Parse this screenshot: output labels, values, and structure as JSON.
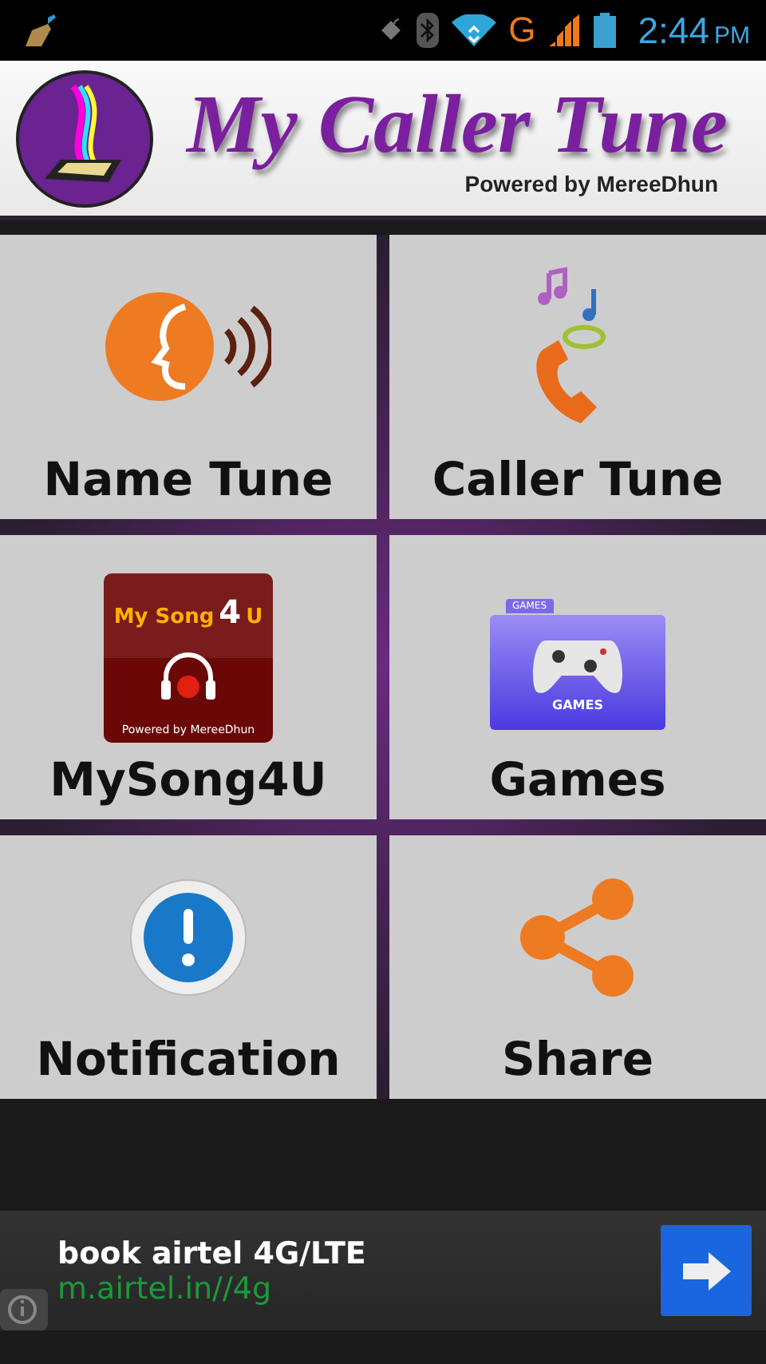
{
  "status_bar": {
    "network": "G",
    "time": "2:44",
    "ampm": "PM"
  },
  "header": {
    "title": "My Caller Tune",
    "subtitle": "Powered by MereeDhun"
  },
  "tiles": [
    {
      "kind": "name",
      "label": "Name Tune"
    },
    {
      "kind": "caller",
      "label": "Caller Tune"
    },
    {
      "kind": "mysong",
      "label": "MySong4U",
      "icon_title": "My Song",
      "icon_num": "4",
      "icon_u": "U",
      "icon_caption": "Powered by MereeDhun"
    },
    {
      "kind": "games",
      "label": "Games",
      "icon_tab": "GAMES",
      "icon_caption": "GAMES"
    },
    {
      "kind": "notification",
      "label": "Notification"
    },
    {
      "kind": "share",
      "label": "Share"
    }
  ],
  "ad": {
    "title": "book airtel 4G/LTE",
    "url": "m.airtel.in//4g"
  }
}
